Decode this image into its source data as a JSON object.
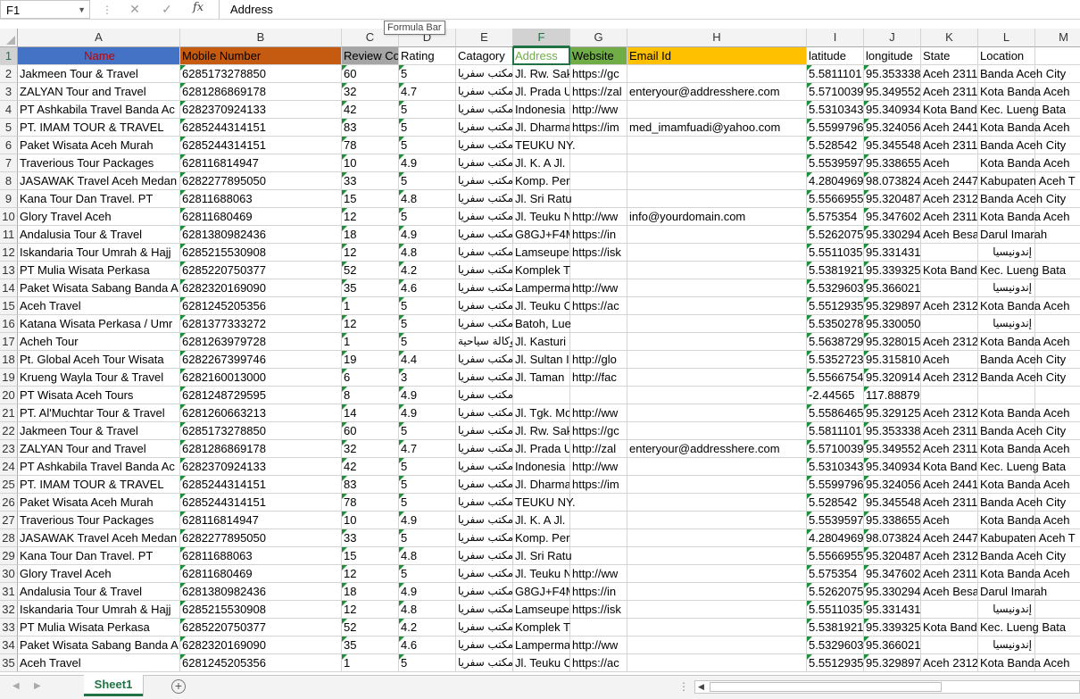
{
  "formula_bar": {
    "name_box": "F1",
    "content": "Address",
    "tooltip": "Formula Bar"
  },
  "columns": [
    "A",
    "B",
    "C",
    "D",
    "E",
    "F",
    "G",
    "H",
    "I",
    "J",
    "K",
    "L",
    "M"
  ],
  "selected_column": "F",
  "headers": {
    "A": "Name",
    "B": "Mobile Number",
    "C": "Review Co",
    "D": "Rating",
    "E": "Catagory",
    "F": "Address",
    "G": "Website",
    "H": "Email Id",
    "I": "latitude",
    "J": "longitude",
    "K": "State",
    "L": "Location",
    "M": ""
  },
  "header_colors": {
    "A": "#4472c4",
    "B": "#c55a11",
    "C": "#a5a5a5",
    "F": "#ffffff",
    "G": "#70ad47",
    "H": "#ffc000"
  },
  "rows": [
    [
      "Jakmeen Tour & Travel",
      "6285173278850",
      "60",
      "5",
      "مكتب سفريا",
      "Jl. Rw. Sak",
      "https://gc",
      "",
      "5.5811101",
      "95.353338",
      "Aceh 2311",
      "Banda Aceh City"
    ],
    [
      "ZALYAN Tour and Travel",
      "6281286869178",
      "32",
      "4.7",
      "مكتب سفريا",
      "Jl. Prada U",
      "https://zal",
      "enteryour@addresshere.com",
      "5.5710039",
      "95.349552",
      "Aceh 2311",
      "Kota Banda Aceh"
    ],
    [
      "PT Ashkabila Travel Banda Ac",
      "6282370924133",
      "42",
      "5",
      "مكتب سفريا",
      "Indonesia",
      "http://ww",
      "",
      "5.5310343",
      "95.340934",
      "Kota Band",
      "Kec. Lueng Bata"
    ],
    [
      "PT. IMAM TOUR & TRAVEL",
      "6285244314151",
      "83",
      "5",
      "مكتب سفريا",
      "Jl. Dharma",
      "https://im",
      "med_imamfuadi@yahoo.com",
      "5.5599796",
      "95.324056",
      "Aceh 2441",
      "Kota Banda Aceh"
    ],
    [
      "Paket Wisata Aceh Murah",
      "6285244314151",
      "78",
      "5",
      "مكتب سفريا",
      "TEUKU NY.",
      "",
      "",
      "5.528542",
      "95.345548",
      "Aceh 2311",
      "Banda Aceh City"
    ],
    [
      "Traverious Tour Packages",
      "628116814947",
      "10",
      "4.9",
      "مكتب سفريا",
      "Jl. K. A Jl.",
      "",
      "",
      "5.5539597",
      "95.338655",
      "Aceh",
      "Kota Banda Aceh"
    ],
    [
      "JASAWAK Travel Aceh Medan",
      "6282277895050",
      "33",
      "5",
      "مكتب سفريا",
      "Komp. Per",
      "",
      "",
      "4.2804969",
      "98.073824",
      "Aceh 2447",
      "Kabupaten Aceh T"
    ],
    [
      "Kana Tour Dan Travel. PT",
      "62811688063",
      "15",
      "4.8",
      "مكتب سفريا",
      "Jl. Sri Ratu",
      "",
      "",
      "5.5566955",
      "95.320487",
      "Aceh 2312",
      "Banda Aceh City"
    ],
    [
      "Glory Travel Aceh",
      "62811680469",
      "12",
      "5",
      "مكتب سفريا",
      "Jl. Teuku N",
      "http://ww",
      "info@yourdomain.com",
      "5.575354",
      "95.347602",
      "Aceh 2311",
      "Kota Banda Aceh"
    ],
    [
      "Andalusia Tour & Travel",
      "6281380982436",
      "18",
      "4.9",
      "مكتب سفريا",
      "G8GJ+F4M",
      "https://in",
      "",
      "5.5262075",
      "95.330294",
      "Aceh Besa",
      "Darul Imarah"
    ],
    [
      "Iskandaria Tour Umrah & Hajj",
      "6285215530908",
      "12",
      "4.8",
      "مكتب سفريا",
      "Lamseupe",
      "https://isk",
      "",
      "5.5511035",
      "95.331431",
      "",
      "إندونيسيا"
    ],
    [
      "PT Mulia Wisata Perkasa",
      "6285220750377",
      "52",
      "4.2",
      "مكتب سفريا",
      "Komplek T",
      "",
      "",
      "5.5381921",
      "95.339325",
      "Kota Band",
      "Kec. Lueng Bata"
    ],
    [
      "Paket Wisata Sabang Banda A",
      "6282320169090",
      "35",
      "4.6",
      "مكتب سفريا",
      "Lamperma",
      "http://ww",
      "",
      "5.5329603",
      "95.366021",
      "",
      "إندونيسيا"
    ],
    [
      "Aceh Travel",
      "6281245205356",
      "1",
      "5",
      "مكتب سفريا",
      "Jl. Teuku C",
      "https://ac",
      "",
      "5.5512935",
      "95.329897",
      "Aceh 2312",
      "Kota Banda Aceh"
    ],
    [
      "Katana Wisata Perkasa / Umr",
      "6281377333272",
      "12",
      "5",
      "مكتب سفريا",
      "Batoh, Lue",
      "",
      "",
      "5.5350278",
      "95.330050",
      "",
      "إندونيسيا"
    ],
    [
      "Acheh Tour",
      "6281263979728",
      "1",
      "5",
      "وكالة سياحية",
      "Jl. Kasturi",
      "",
      "",
      "5.5638729",
      "95.328015",
      "Aceh 2312",
      "Kota Banda Aceh"
    ],
    [
      "Pt. Global Aceh Tour Wisata",
      "6282267399746",
      "19",
      "4.4",
      "مكتب سفريا",
      "Jl. Sultan I",
      "http://glo",
      "",
      "5.5352723",
      "95.315810",
      "Aceh",
      "Banda Aceh City"
    ],
    [
      "Krueng Wayla Tour & Travel",
      "6282160013000",
      "6",
      "3",
      "مكتب سفريا",
      "Jl. Taman",
      "http://fac",
      "",
      "5.5566754",
      "95.320914",
      "Aceh 2312",
      "Banda Aceh City"
    ],
    [
      "PT Wisata Aceh Tours",
      "6281248729595",
      "8",
      "4.9",
      "مكتب سفريا",
      "",
      "",
      "",
      "-2.44565",
      "117.88879",
      "",
      ""
    ],
    [
      "PT. Al'Muchtar Tour & Travel",
      "6281260663213",
      "14",
      "4.9",
      "مكتب سفريا",
      "Jl. Tgk. Mc",
      "http://ww",
      "",
      "5.5586465",
      "95.329125",
      "Aceh 2312",
      "Kota Banda Aceh"
    ],
    [
      "Jakmeen Tour & Travel",
      "6285173278850",
      "60",
      "5",
      "مكتب سفريا",
      "Jl. Rw. Sak",
      "https://gc",
      "",
      "5.5811101",
      "95.353338",
      "Aceh 2311",
      "Banda Aceh City"
    ],
    [
      "ZALYAN Tour and Travel",
      "6281286869178",
      "32",
      "4.7",
      "مكتب سفريا",
      "Jl. Prada U",
      "http://zal",
      "enteryour@addresshere.com",
      "5.5710039",
      "95.349552",
      "Aceh 2311",
      "Kota Banda Aceh"
    ],
    [
      "PT Ashkabila Travel Banda Ac",
      "6282370924133",
      "42",
      "5",
      "مكتب سفريا",
      "Indonesia",
      "http://ww",
      "",
      "5.5310343",
      "95.340934",
      "Kota Band",
      "Kec. Lueng Bata"
    ],
    [
      "PT. IMAM TOUR & TRAVEL",
      "6285244314151",
      "83",
      "5",
      "مكتب سفريا",
      "Jl. Dharma",
      "https://im",
      "",
      "5.5599796",
      "95.324056",
      "Aceh 2441",
      "Kota Banda Aceh"
    ],
    [
      "Paket Wisata Aceh Murah",
      "6285244314151",
      "78",
      "5",
      "مكتب سفريا",
      "TEUKU NY.",
      "",
      "",
      "5.528542",
      "95.345548",
      "Aceh 2311",
      "Banda Aceh City"
    ],
    [
      "Traverious Tour Packages",
      "628116814947",
      "10",
      "4.9",
      "مكتب سفريا",
      "Jl. K. A Jl.",
      "",
      "",
      "5.5539597",
      "95.338655",
      "Aceh",
      "Kota Banda Aceh"
    ],
    [
      "JASAWAK Travel Aceh Medan",
      "6282277895050",
      "33",
      "5",
      "مكتب سفريا",
      "Komp. Per",
      "",
      "",
      "4.2804969",
      "98.073824",
      "Aceh 2447",
      "Kabupaten Aceh T"
    ],
    [
      "Kana Tour Dan Travel. PT",
      "62811688063",
      "15",
      "4.8",
      "مكتب سفريا",
      "Jl. Sri Ratu",
      "",
      "",
      "5.5566955",
      "95.320487",
      "Aceh 2312",
      "Banda Aceh City"
    ],
    [
      "Glory Travel Aceh",
      "62811680469",
      "12",
      "5",
      "مكتب سفريا",
      "Jl. Teuku N",
      "http://ww",
      "",
      "5.575354",
      "95.347602",
      "Aceh 2311",
      "Kota Banda Aceh"
    ],
    [
      "Andalusia Tour & Travel",
      "6281380982436",
      "18",
      "4.9",
      "مكتب سفريا",
      "G8GJ+F4M",
      "https://in",
      "",
      "5.5262075",
      "95.330294",
      "Aceh Besa",
      "Darul Imarah"
    ],
    [
      "Iskandaria Tour Umrah & Hajj",
      "6285215530908",
      "12",
      "4.8",
      "مكتب سفريا",
      "Lamseupe",
      "https://isk",
      "",
      "5.5511035",
      "95.331431",
      "",
      "إندونيسيا"
    ],
    [
      "PT Mulia Wisata Perkasa",
      "6285220750377",
      "52",
      "4.2",
      "مكتب سفريا",
      "Komplek T",
      "",
      "",
      "5.5381921",
      "95.339325",
      "Kota Band",
      "Kec. Lueng Bata"
    ],
    [
      "Paket Wisata Sabang Banda A",
      "6282320169090",
      "35",
      "4.6",
      "مكتب سفريا",
      "Lamperma",
      "http://ww",
      "",
      "5.5329603",
      "95.366021",
      "",
      "إندونيسيا"
    ],
    [
      "Aceh Travel",
      "6281245205356",
      "1",
      "5",
      "مكتب سفريا",
      "Jl. Teuku C",
      "https://ac",
      "",
      "5.5512935",
      "95.329897",
      "Aceh 2312",
      "Kota Banda Aceh"
    ]
  ],
  "sheet_tabs": [
    "Sheet1"
  ],
  "active_sheet": "Sheet1",
  "icons": {
    "name_box_dropdown": "chevron-down-icon",
    "cancel": "close-icon",
    "enter": "check-icon",
    "insert_function": "fx-icon",
    "add_sheet": "plus-circle-icon"
  }
}
